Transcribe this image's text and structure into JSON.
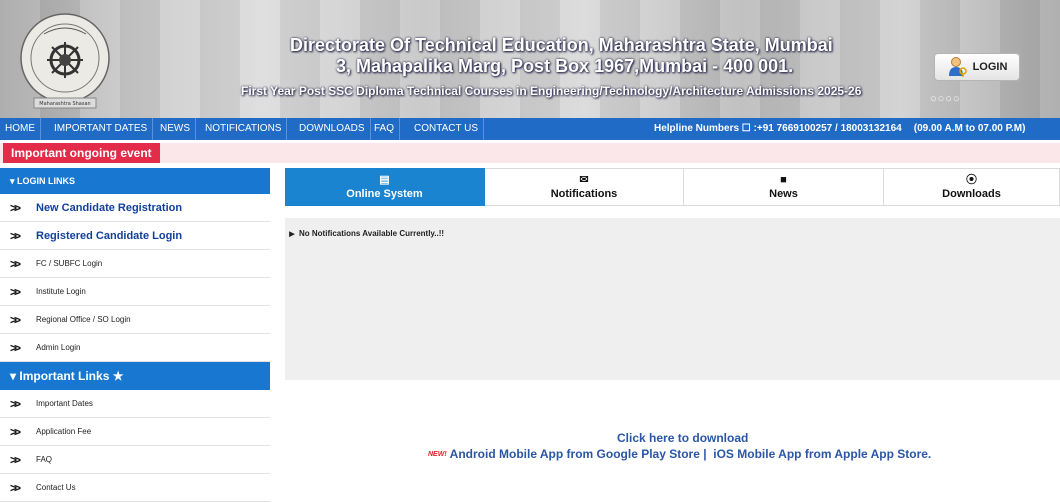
{
  "header": {
    "title_line1": "Directorate Of Technical Education, Maharashtra State, Mumbai",
    "title_line2": "3, Mahapalika Marg, Post Box 1967,Mumbai - 400 001.",
    "title_line3": "First Year Post SSC Diploma Technical Courses in Engineering/Technology/Architecture Admissions 2025-26",
    "login_label": "LOGIN",
    "logo_caption": "Maharashtra Shasan"
  },
  "nav": {
    "items": [
      "HOME",
      "IMPORTANT DATES",
      "NEWS",
      "NOTIFICATIONS",
      "DOWNLOADS",
      "FAQ",
      "CONTACT US"
    ],
    "helpline": "Helpline Numbers ☐ :+91 7669100257 / 18003132164",
    "hours": "(09.00 A.M to 07.00 P.M)"
  },
  "event": {
    "label": "Important ongoing event"
  },
  "sidebar": {
    "login_heading": "▾ LOGIN LINKS 👤",
    "login_items": [
      "New Candidate Registration",
      "Registered Candidate Login",
      "FC / SUBFC Login",
      "Institute Login",
      "Regional Office / SO Login",
      "Admin Login"
    ],
    "important_heading": "▾ Important Links ★",
    "important_items": [
      "Important Dates",
      "Application Fee",
      "FAQ",
      "Contact Us"
    ]
  },
  "tabs": [
    {
      "label": "Online System",
      "icon": "▤"
    },
    {
      "label": "Notifications",
      "icon": "✉"
    },
    {
      "label": "News",
      "icon": "■"
    },
    {
      "label": "Downloads",
      "icon": "⦿"
    }
  ],
  "notifications": {
    "message": "No Notifications Available Currently..!!"
  },
  "download": {
    "line1": "Click here to download",
    "new_badge": "NEW!",
    "android": "Android Mobile App from Google Play Store |",
    "ios": "iOS Mobile App from Apple App Store."
  },
  "colors": {
    "nav_blue": "#1f6bc5",
    "sidebar_blue": "#1877d0",
    "tab_active": "#1a84d0",
    "event_red": "#e22c4a",
    "link_blue": "#2b56a5"
  }
}
